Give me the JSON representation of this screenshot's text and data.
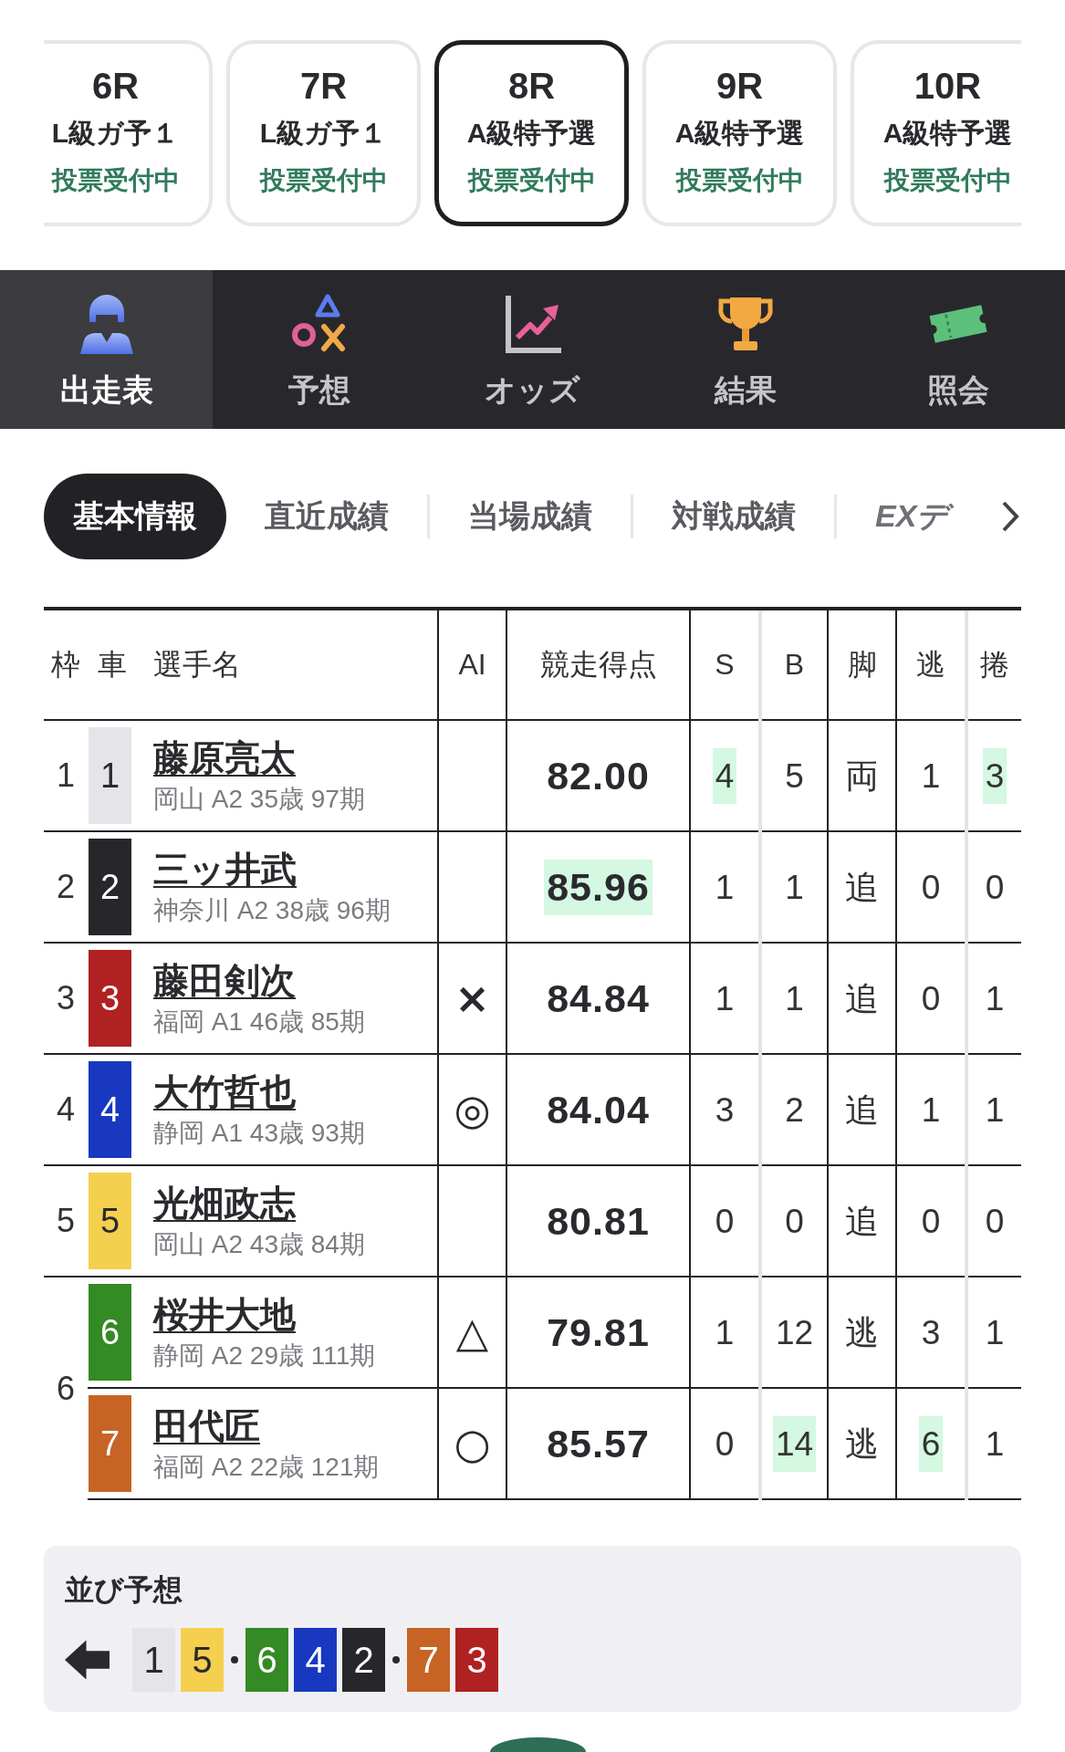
{
  "race_tabs": [
    {
      "race": "6R",
      "class": "L級ガ予１",
      "status": "投票受付中",
      "selected": false
    },
    {
      "race": "7R",
      "class": "L級ガ予１",
      "status": "投票受付中",
      "selected": false
    },
    {
      "race": "8R",
      "class": "A級特予選",
      "status": "投票受付中",
      "selected": true
    },
    {
      "race": "9R",
      "class": "A級特予選",
      "status": "投票受付中",
      "selected": false
    },
    {
      "race": "10R",
      "class": "A級特予選",
      "status": "投票受付中",
      "selected": false
    }
  ],
  "nav": [
    {
      "label": "出走表",
      "kind": "rider",
      "selected": true
    },
    {
      "label": "予想",
      "kind": "forecast",
      "selected": false
    },
    {
      "label": "オッズ",
      "kind": "odds",
      "selected": false
    },
    {
      "label": "結果",
      "kind": "results",
      "selected": false
    },
    {
      "label": "照会",
      "kind": "ticket",
      "selected": false
    }
  ],
  "sub_tabs": [
    {
      "label": "基本情報",
      "selected": true
    },
    {
      "label": "直近成績",
      "selected": false
    },
    {
      "label": "当場成績",
      "selected": false
    },
    {
      "label": "対戦成績",
      "selected": false
    },
    {
      "label": "EXデ",
      "selected": false
    }
  ],
  "table": {
    "columns": [
      "枠",
      "車",
      "選手名",
      "AI",
      "競走得点",
      "S",
      "B",
      "脚",
      "逃",
      "捲"
    ],
    "frames": [
      {
        "frame": "1",
        "riders": [
          {
            "car": "1",
            "color": "#e4e4e9",
            "name": "藤原亮太",
            "info": "岡山 A2 35歳 97期",
            "score": {
              "value": "82.00",
              "highlighted": false
            },
            "s": {
              "value": "4",
              "highlighted": true
            },
            "b": {
              "value": "5",
              "highlighted": false
            },
            "leg": {
              "value": "両",
              "highlighted": false
            },
            "escape": {
              "value": "1",
              "highlighted": false
            },
            "makuri": {
              "value": "3",
              "highlighted": true
            }
          }
        ]
      },
      {
        "frame": "2",
        "riders": [
          {
            "car": "2",
            "color": "#27272b",
            "name": "三ッ井武",
            "info": "神奈川 A2 38歳 96期",
            "score": {
              "value": "85.96",
              "highlighted": true
            },
            "s": {
              "value": "1",
              "highlighted": false
            },
            "b": {
              "value": "1",
              "highlighted": false
            },
            "leg": {
              "value": "追",
              "highlighted": false
            },
            "escape": {
              "value": "0",
              "highlighted": false
            },
            "makuri": {
              "value": "0",
              "highlighted": false
            }
          }
        ]
      },
      {
        "frame": "3",
        "riders": [
          {
            "car": "3",
            "color": "#b02121",
            "name": "藤田剣次",
            "info": "福岡 A1 46歳 85期",
            "ai": "×",
            "score": {
              "value": "84.84",
              "highlighted": false
            },
            "s": {
              "value": "1",
              "highlighted": false
            },
            "b": {
              "value": "1",
              "highlighted": false
            },
            "leg": {
              "value": "追",
              "highlighted": false
            },
            "escape": {
              "value": "0",
              "highlighted": false
            },
            "makuri": {
              "value": "1",
              "highlighted": false
            }
          }
        ]
      },
      {
        "frame": "4",
        "riders": [
          {
            "car": "4",
            "color": "#1838c0",
            "name": "大竹哲也",
            "info": "静岡 A1 43歳 93期",
            "ai": "◎",
            "score": {
              "value": "84.04",
              "highlighted": false
            },
            "s": {
              "value": "3",
              "highlighted": false
            },
            "b": {
              "value": "2",
              "highlighted": false
            },
            "leg": {
              "value": "追",
              "highlighted": false
            },
            "escape": {
              "value": "1",
              "highlighted": false
            },
            "makuri": {
              "value": "1",
              "highlighted": false
            }
          }
        ]
      },
      {
        "frame": "5",
        "riders": [
          {
            "car": "5",
            "color": "#f5cf4e",
            "name": "光畑政志",
            "info": "岡山 A2 43歳 84期",
            "score": {
              "value": "80.81",
              "highlighted": false
            },
            "s": {
              "value": "0",
              "highlighted": false
            },
            "b": {
              "value": "0",
              "highlighted": false
            },
            "leg": {
              "value": "追",
              "highlighted": false
            },
            "escape": {
              "value": "0",
              "highlighted": false
            },
            "makuri": {
              "value": "0",
              "highlighted": false
            }
          }
        ]
      },
      {
        "frame": "6",
        "riders": [
          {
            "car": "6",
            "color": "#348a24",
            "name": "桜井大地",
            "info": "静岡 A2 29歳 111期",
            "ai": "△",
            "score": {
              "value": "79.81",
              "highlighted": false
            },
            "s": {
              "value": "1",
              "highlighted": false
            },
            "b": {
              "value": "12",
              "highlighted": false
            },
            "leg": {
              "value": "逃",
              "highlighted": false
            },
            "escape": {
              "value": "3",
              "highlighted": false
            },
            "makuri": {
              "value": "1",
              "highlighted": false
            }
          },
          {
            "car": "7",
            "color": "#c76425",
            "name": "田代匠",
            "info": "福岡 A2 22歳 121期",
            "ai": "○",
            "score": {
              "value": "85.57",
              "highlighted": false
            },
            "s": {
              "value": "0",
              "highlighted": false
            },
            "b": {
              "value": "14",
              "highlighted": true
            },
            "leg": {
              "value": "逃",
              "highlighted": false
            },
            "escape": {
              "value": "6",
              "highlighted": true
            },
            "makuri": {
              "value": "1",
              "highlighted": false
            }
          }
        ]
      }
    ]
  },
  "line_forecast": {
    "title": "並び予想",
    "groups": [
      {
        "cars": [
          {
            "number": "1",
            "color": "#e4e4e9"
          },
          {
            "number": "5",
            "color": "#f5cf4e"
          }
        ]
      },
      {
        "cars": [
          {
            "number": "6",
            "color": "#348a24"
          },
          {
            "number": "4",
            "color": "#1838c0"
          },
          {
            "number": "2",
            "color": "#27272b"
          }
        ]
      },
      {
        "cars": [
          {
            "number": "7",
            "color": "#c76425"
          },
          {
            "number": "3",
            "color": "#b02121"
          }
        ]
      }
    ]
  }
}
